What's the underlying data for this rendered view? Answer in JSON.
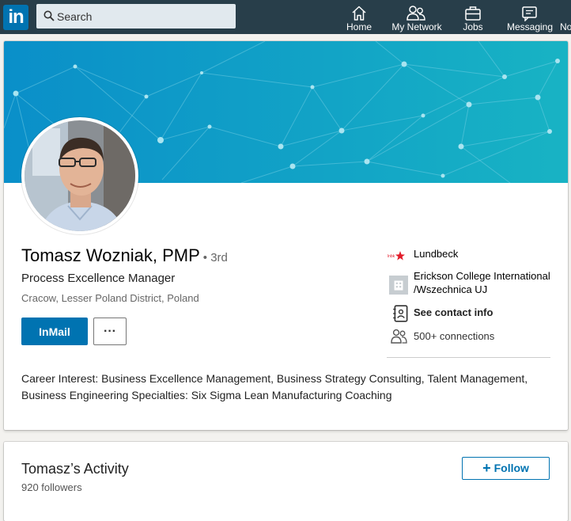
{
  "nav": {
    "logo": "in",
    "search_placeholder": "Search",
    "items": [
      {
        "label": "Home",
        "icon": "home-icon"
      },
      {
        "label": "My Network",
        "icon": "network-icon"
      },
      {
        "label": "Jobs",
        "icon": "briefcase-icon"
      },
      {
        "label": "Messaging",
        "icon": "messaging-icon"
      },
      {
        "label": "No",
        "icon": "bell-icon"
      }
    ]
  },
  "profile": {
    "name": "Tomasz Wozniak, PMP",
    "degree": "• 3rd",
    "headline": "Process Excellence Manager",
    "location": "Cracow, Lesser Poland District, Poland",
    "inmail_label": "InMail",
    "more_label": "···",
    "company": "Lundbeck",
    "school": "Erickson College International /Wszechnica UJ",
    "contact": "See contact info",
    "connections": "500+ connections",
    "interest": "Career Interest: Business Excellence Management, Business Strategy Consulting, Talent Management, Business Engineering Specialties: Six Sigma Lean Manufacturing Coaching"
  },
  "activity": {
    "title": "Tomasz’s Activity",
    "followers": "920 followers",
    "follow_label": "Follow"
  },
  "colors": {
    "nav_bg": "#283e4a",
    "brand_blue": "#0073b1",
    "banner_start": "#0a8fc9",
    "banner_end": "#18b3c4"
  }
}
